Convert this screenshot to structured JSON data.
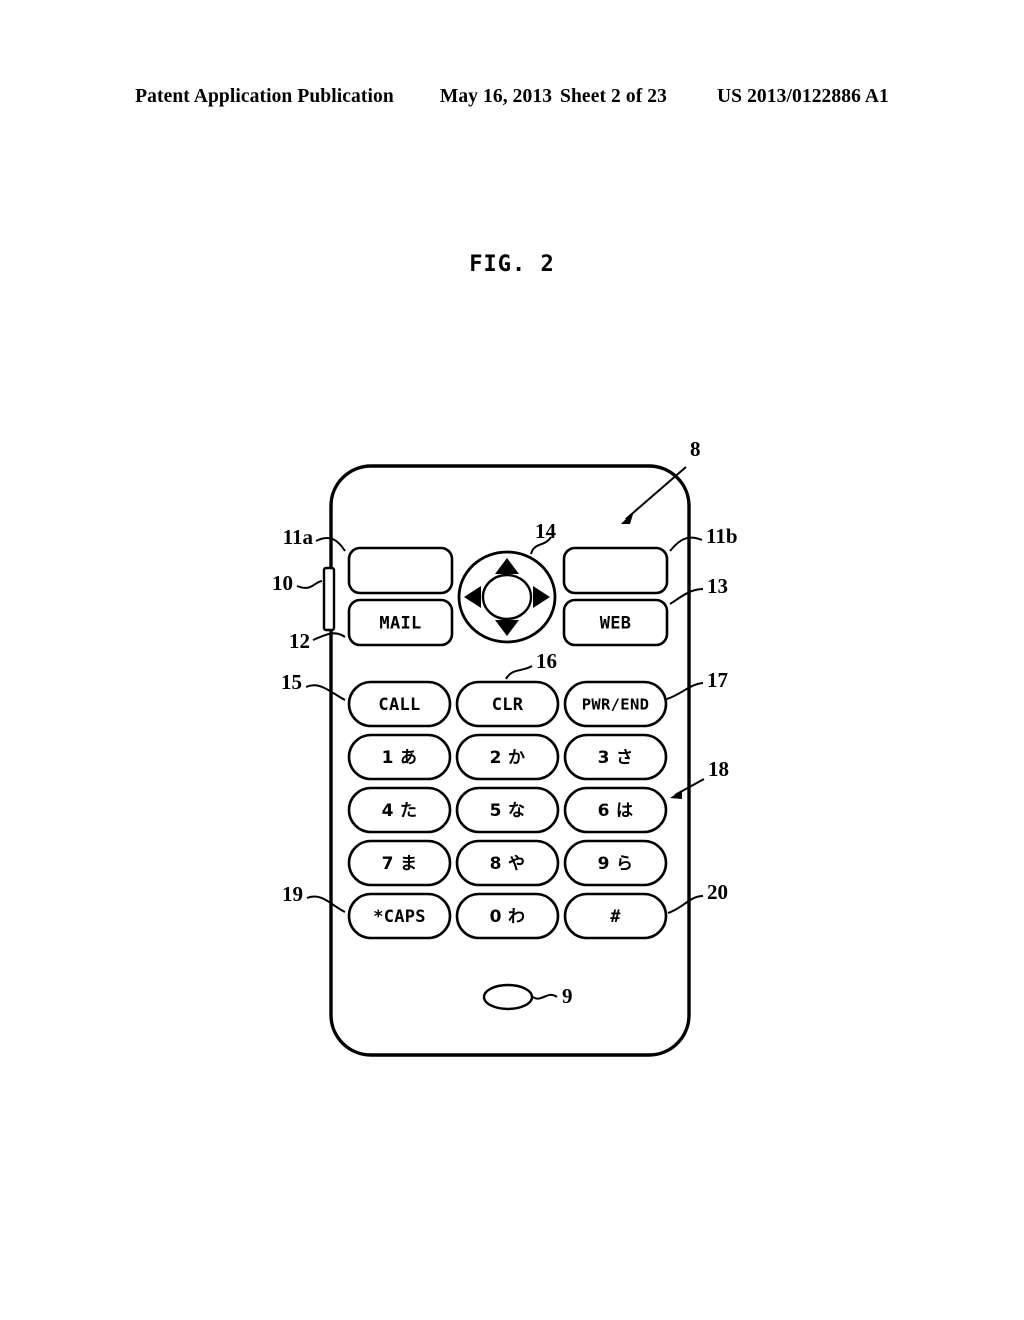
{
  "header": {
    "publication": "Patent Application Publication",
    "date": "May 16, 2013",
    "sheet": "Sheet 2 of 23",
    "patent_number": "US 2013/0122886 A1"
  },
  "figure": {
    "title": "FIG. 2",
    "device": "mobile phone keypad face",
    "mic_icon": "microphone-ellipse"
  },
  "keys": {
    "softkey_left": "",
    "softkey_right": "",
    "mail": "MAIL",
    "web": "WEB",
    "call": "CALL",
    "clr": "CLR",
    "pwr_end": "PWR/END",
    "k1": "1 あ",
    "k2": "2 か",
    "k3": "3 さ",
    "k4": "4 た",
    "k5": "5 な",
    "k6": "6 は",
    "k7": "7 ま",
    "k8": "8 や",
    "k9": "9 ら",
    "kstar": "*CAPS",
    "k0": "0 わ",
    "khash": "#"
  },
  "reference_numerals": {
    "body": "8",
    "microphone": "9",
    "side_button": "10",
    "softkey_left": "11a",
    "softkey_right": "11b",
    "mail_key": "12",
    "web_key": "13",
    "dpad": "14",
    "call_key": "15",
    "clr_key": "16",
    "pwr_end_key": "17",
    "numeric_keypad": "18",
    "star_key": "19",
    "hash_key": "20"
  },
  "colors": {
    "ink": "#000000",
    "paper": "#ffffff"
  }
}
